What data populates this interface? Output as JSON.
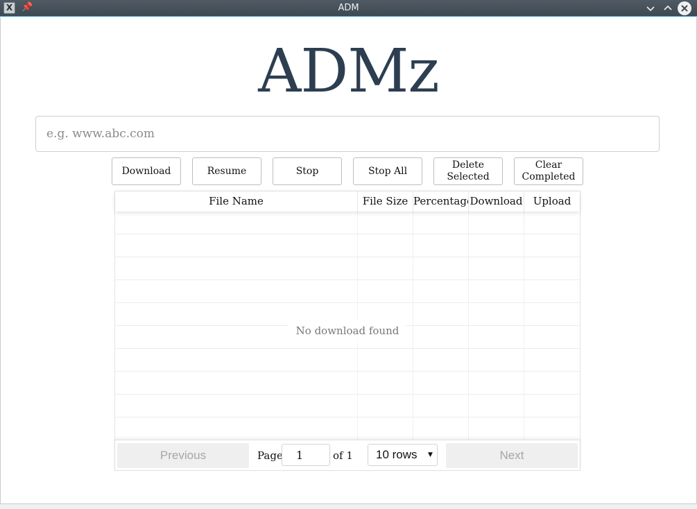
{
  "window": {
    "title": "ADM",
    "app_icon": "x-app-icon",
    "pin_icon": "pin-icon"
  },
  "app": {
    "heading": "ADMz"
  },
  "url_input": {
    "placeholder": "e.g. www.abc.com",
    "value": ""
  },
  "actions": {
    "download": "Download",
    "resume": "Resume",
    "stop": "Stop",
    "stop_all": "Stop All",
    "delete_selected": "Delete\nSelected",
    "clear_completed": "Clear\nCompleted"
  },
  "table": {
    "columns": [
      "File Name",
      "File Size",
      "Percentage",
      "Download",
      "Upload"
    ],
    "rows": [],
    "empty_message": "No download found"
  },
  "pagination": {
    "previous": "Previous",
    "next": "Next",
    "page_label": "Page",
    "page_value": "1",
    "of_label": "of 1",
    "rows_selected": "10 rows"
  },
  "colors": {
    "titlebar": "#48535c",
    "title_accent": "#2c3e50",
    "frame_accent": "#2b8fd6"
  }
}
